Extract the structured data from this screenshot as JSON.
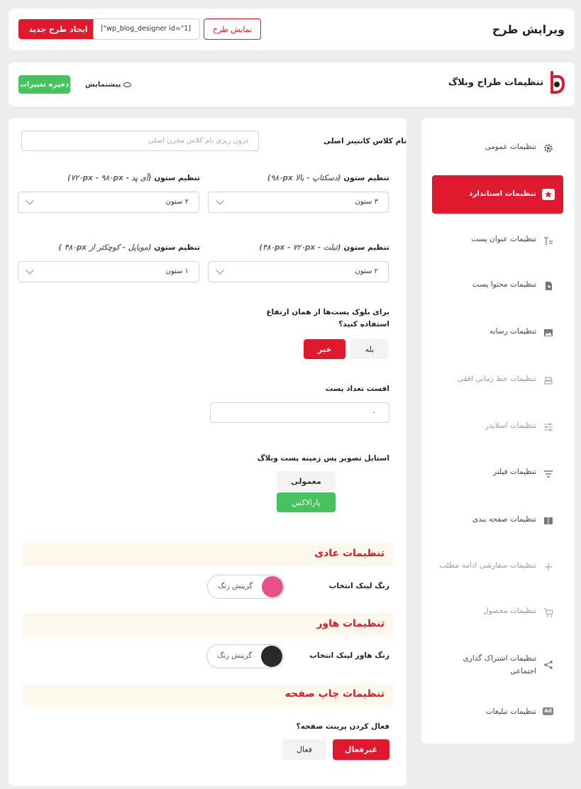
{
  "header": {
    "page_title": "ویرایش طرح",
    "create_new_label": "ایجاد طرح جدید",
    "shortcode": "[\"wp_blog_designer id=\"1]",
    "show_layout_label": "نمایش طرح"
  },
  "subheader": {
    "brand_title": "تنظیمات طراح وبلاگ",
    "preview_label": "پیشنمایش",
    "save_label": "ذخیره تغییرات"
  },
  "sidebar": {
    "items": [
      {
        "label": "تنظیمات عمومی",
        "icon": "gear-icon"
      },
      {
        "label": "تنظیمات استاندارد",
        "icon": "star-badge-icon",
        "active": true
      },
      {
        "label": "تنظیمات عنوان پست",
        "icon": "text-title-icon"
      },
      {
        "label": "تنظیمات محتوا پست",
        "icon": "document-add-icon"
      },
      {
        "label": "تنظیمات رسانه",
        "icon": "image-icon"
      },
      {
        "label": "تنظیمات خط زمانی افقی",
        "icon": "timeline-icon"
      },
      {
        "label": "تنظیمات اسلایدر",
        "icon": "sliders-icon"
      },
      {
        "label": "تنظیمات فیلتر",
        "icon": "filter-icon"
      },
      {
        "label": "تنظیمات صفحه بندی",
        "icon": "book-icon"
      },
      {
        "label": "تنظیمات سفارشی ادامه مطلب",
        "icon": "plus-icon"
      },
      {
        "label": "تنظیمات محصول",
        "icon": "cart-icon"
      },
      {
        "label": "تنظیمات اشتراک گذاری اجتماعی",
        "icon": "share-icon"
      },
      {
        "label": "تنظیمات تبلیغات",
        "icon": "ad-icon"
      }
    ]
  },
  "form": {
    "container_class": {
      "label": "نام کلاس کانتینر اصلی",
      "placeholder": "درون ریزی نام کلاس مخزن اصلی"
    },
    "col_desktop": {
      "label": "تنظیم ستون",
      "hint": "(دسکتاپ - بالا ۹۸۰px)",
      "value": "۳ ستون"
    },
    "col_ipad": {
      "label": "تنظیم ستون",
      "hint": "(آی پد - ۷۲۰px - ۹۸۰px)",
      "value": "۲ ستون"
    },
    "col_tablet": {
      "label": "تنظیم ستون",
      "hint": "(تبلت - ۴۸۰px - ۷۲۰px)",
      "value": "۲ ستون"
    },
    "col_mobile": {
      "label": "تنظیم ستون",
      "hint": "(موبایل - کوچکتر از ۴۸۰px )",
      "value": "۱ ستون"
    },
    "same_height": {
      "label_line1": "برای بلوک پست‌ها از همان ارتفاع",
      "label_line2": "استفاده کنید؟",
      "yes": "بله",
      "no": "خیر",
      "selected": "خیر"
    },
    "offset": {
      "label": "افست تعداد پست",
      "value": "۰"
    },
    "bg_style": {
      "label": "استایل تصویر پس زمینه پست وبلاگ",
      "normal": "معمولی",
      "parallax": "پارالاکس",
      "selected": "پارالاکس"
    },
    "normal_section": {
      "title": "تنظیمات عادی",
      "link_color_label": "رنگ لینک انتخاب",
      "picker_label": "گزینش رنگ",
      "color": "#e8508a"
    },
    "hover_section": {
      "title": "تنظیمات هاور",
      "link_color_label": "رنگ هاور لینک انتخاب",
      "picker_label": "گزینش رنگ",
      "color": "#2a2a2a"
    },
    "print_section": {
      "title": "تنظیمات چاپ صفحه",
      "enable_label": "فعال کردن پرینت صفحه؟",
      "active": "فعال",
      "inactive": "غیرفعال",
      "selected": "غیرفعال"
    }
  },
  "colors": {
    "accent": "#e0192e",
    "success": "#46c35f"
  }
}
